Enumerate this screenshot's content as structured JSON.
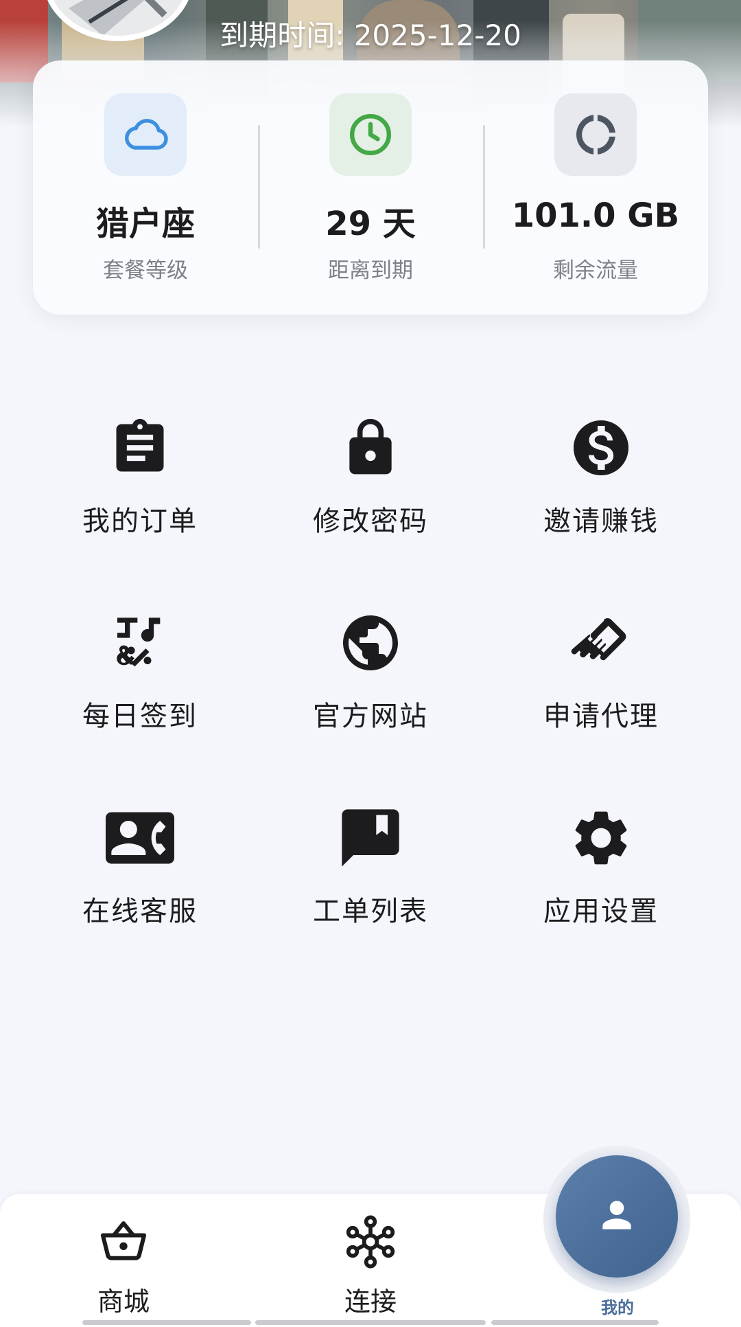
{
  "header": {
    "expire_text": "到期时间: 2025-12-20"
  },
  "stats": [
    {
      "icon": "cloud-icon",
      "value": "猎户座",
      "label": "套餐等级",
      "icon_color": "#3d8fe0",
      "icon_bg": "#e2edf9"
    },
    {
      "icon": "clock-icon",
      "value": "29 天",
      "label": "距离到期",
      "icon_color": "#43a845",
      "icon_bg": "#e4efe6"
    },
    {
      "icon": "donut-icon",
      "value": "101.0 GB",
      "label": "剩余流量",
      "icon_color": "#4d5561",
      "icon_bg": "#e7e9ee"
    }
  ],
  "features": [
    {
      "icon": "clipboard-icon",
      "label": "我的订单"
    },
    {
      "icon": "lock-icon",
      "label": "修改密码"
    },
    {
      "icon": "dollar-icon",
      "label": "邀请赚钱"
    },
    {
      "icon": "symbols-icon",
      "label": "每日签到"
    },
    {
      "icon": "globe-icon",
      "label": "官方网站"
    },
    {
      "icon": "handshake-icon",
      "label": "申请代理"
    },
    {
      "icon": "contact-phone-icon",
      "label": "在线客服"
    },
    {
      "icon": "chat-bookmark-icon",
      "label": "工单列表"
    },
    {
      "icon": "gear-icon",
      "label": "应用设置"
    }
  ],
  "nav": {
    "items": [
      {
        "icon": "basket-icon",
        "label": "商城"
      },
      {
        "icon": "hub-icon",
        "label": "连接"
      },
      {
        "icon": "person-icon",
        "label": "我的"
      }
    ],
    "active_color": "#4a6d99"
  }
}
